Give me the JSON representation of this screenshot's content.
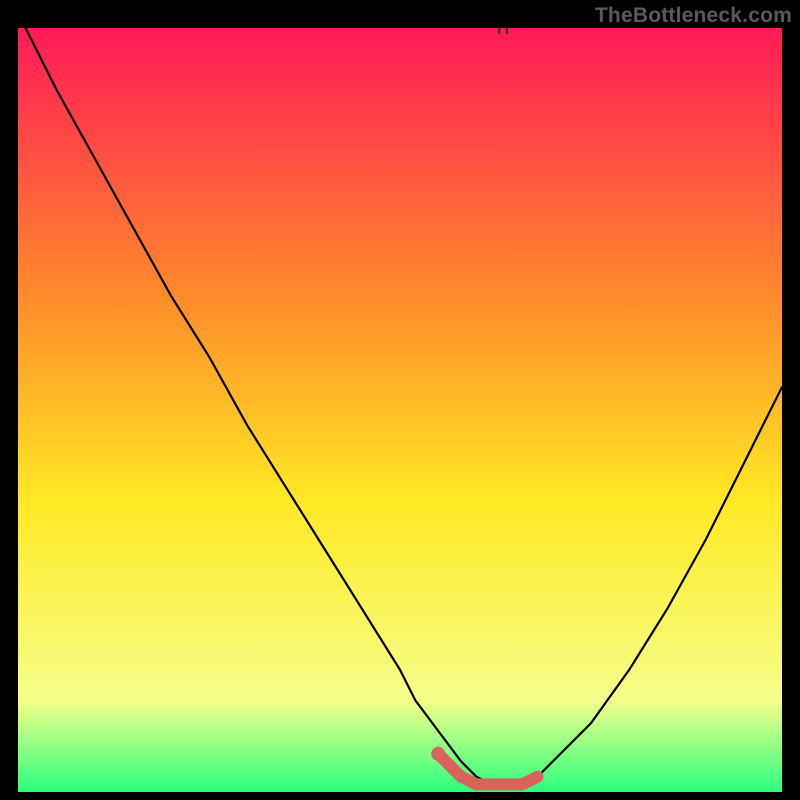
{
  "watermark": "TheBottleneck.com",
  "colors": {
    "page_bg": "#000000",
    "gradient_top": "#ff1a58",
    "gradient_mid1": "#ff8a2b",
    "gradient_mid2": "#ffe924",
    "gradient_low": "#f6ff8a",
    "gradient_bottom": "#2aff7e",
    "curve": "#000000",
    "marker": "#d9635b",
    "tick": "#2e2e2e"
  },
  "chart_data": {
    "type": "line",
    "title": "",
    "xlabel": "",
    "ylabel": "",
    "xlim": [
      0,
      100
    ],
    "ylim": [
      0,
      100
    ],
    "series": [
      {
        "name": "bottleneck-curve",
        "x": [
          1,
          5,
          10,
          15,
          20,
          25,
          30,
          35,
          40,
          45,
          50,
          52,
          55,
          58,
          60,
          62,
          64,
          66,
          68,
          70,
          75,
          80,
          85,
          90,
          95,
          100
        ],
        "values": [
          100,
          92,
          83,
          74,
          65,
          57,
          48,
          40,
          32,
          24,
          16,
          12,
          8,
          4,
          2,
          1,
          1,
          1,
          2,
          4,
          9,
          16,
          24,
          33,
          43,
          53
        ]
      }
    ],
    "markers": {
      "name": "optimal-region",
      "x": [
        55,
        58,
        60,
        62,
        64,
        66,
        68
      ],
      "values": [
        5,
        2,
        1,
        1,
        1,
        1,
        2
      ]
    },
    "ticks_top_x": [
      63,
      64
    ]
  }
}
